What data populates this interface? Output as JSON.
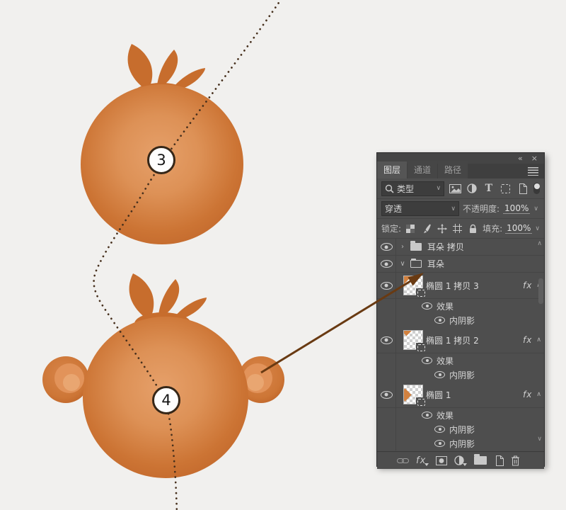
{
  "artwork": {
    "background_color": "#f1f0ee",
    "dotted_path_color": "#47301d",
    "arrow_color": "#693a12",
    "monkey": {
      "head_light": "#e6a06a",
      "head_dark": "#c2682c",
      "hair_color": "#c76d2d",
      "ear_outer": "#cd7636",
      "ear_inner": "#e2935a",
      "ear_core": "#e9a671"
    },
    "steps": {
      "top": "3",
      "bottom": "4"
    }
  },
  "panel": {
    "window": {
      "collapse_icon": "«",
      "close_icon": "×"
    },
    "tabs": [
      {
        "label": "图层"
      },
      {
        "label": "通道"
      },
      {
        "label": "路径"
      }
    ],
    "filter": {
      "type_label": "类型"
    },
    "blend": {
      "mode": "穿透",
      "opacity_label": "不透明度:",
      "opacity_value": "100%"
    },
    "lock": {
      "label": "锁定:",
      "fill_label": "填充:",
      "fill_value": "100%"
    },
    "icons": {
      "caret": "∨",
      "chevron_right": "›",
      "chevron_down": "∨",
      "chevron_up": "∧",
      "fx": "fx"
    },
    "layers": [
      {
        "label": "耳朵 拷贝"
      },
      {
        "label": "耳朵"
      },
      {
        "label": "椭圆 1 拷贝 3"
      },
      {
        "label": "效果"
      },
      {
        "label": "内阴影"
      },
      {
        "label": "椭圆 1 拷贝 2"
      },
      {
        "label": "效果"
      },
      {
        "label": "内阴影"
      },
      {
        "label": "椭圆 1"
      },
      {
        "label": "效果"
      },
      {
        "label": "内阴影"
      },
      {
        "label": "内阴影"
      }
    ]
  }
}
